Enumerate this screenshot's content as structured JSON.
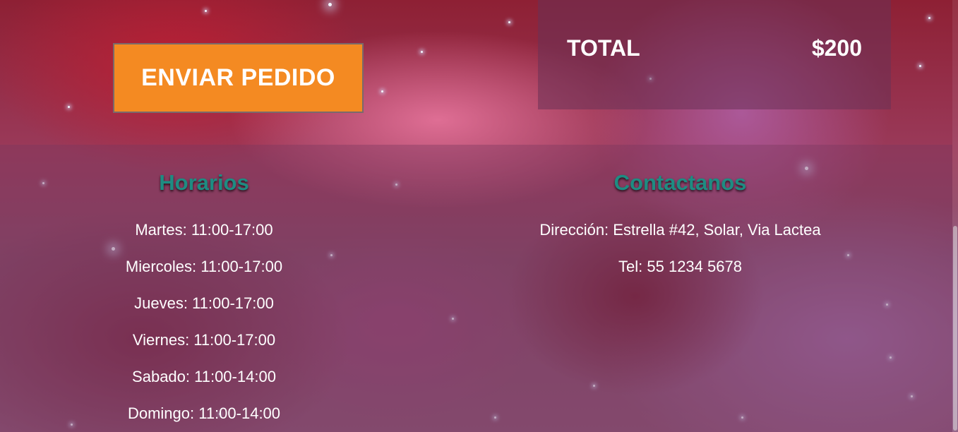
{
  "order": {
    "send_button_label": "ENVIAR PEDIDO",
    "total_label": "TOTAL",
    "total_amount": "$200",
    "accent_color": "#f48a22"
  },
  "footer": {
    "hours": {
      "title": "Horarios",
      "lines": [
        "Martes: 11:00-17:00",
        "Miercoles: 11:00-17:00",
        "Jueves: 11:00-17:00",
        "Viernes: 11:00-17:00",
        "Sabado: 11:00-14:00",
        "Domingo: 11:00-14:00"
      ]
    },
    "contact": {
      "title": "Contactanos",
      "address": "Dirección: Estrella #42, Solar, Via Lactea",
      "phone": "Tel: 55 1234 5678"
    },
    "heading_color": "#1e8c82"
  }
}
